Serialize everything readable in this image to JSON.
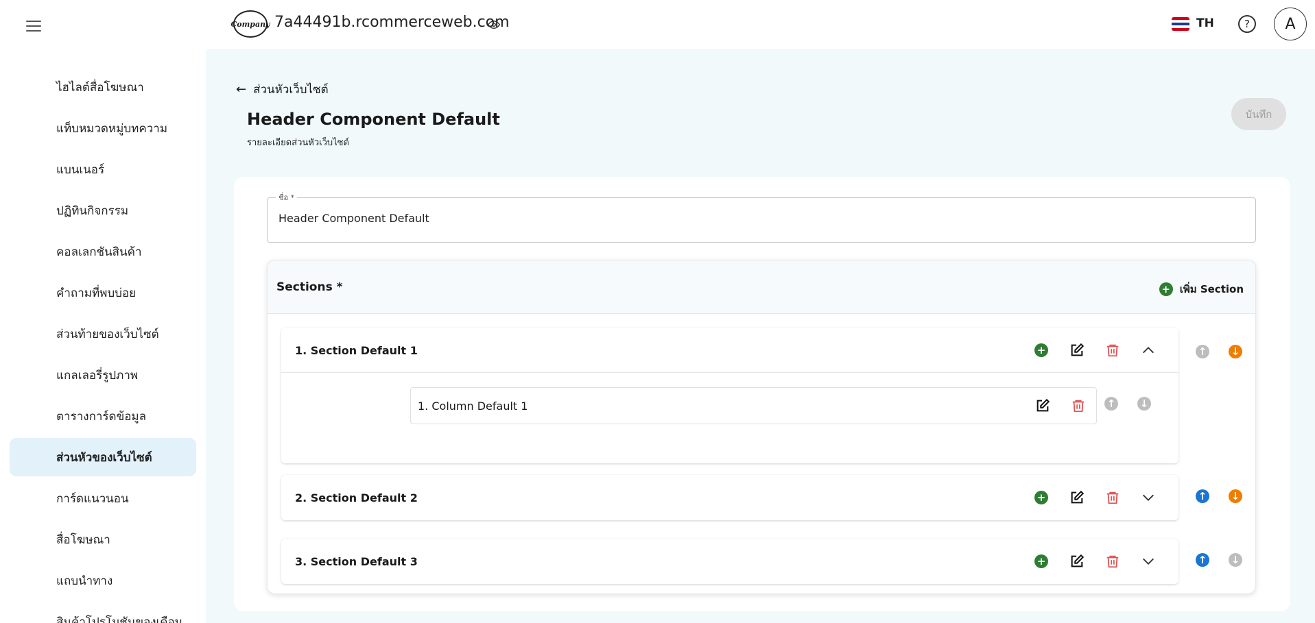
{
  "sidebar": {
    "items": [
      {
        "label": "ไฮไลต์สื่อโฆษณา",
        "active": false
      },
      {
        "label": "แท็บหมวดหมู่บทความ",
        "active": false
      },
      {
        "label": "แบนเนอร์",
        "active": false
      },
      {
        "label": "ปฏิทินกิจกรรม",
        "active": false
      },
      {
        "label": "คอลเลกชันสินค้า",
        "active": false
      },
      {
        "label": "คำถามที่พบบ่อย",
        "active": false
      },
      {
        "label": "ส่วนท้ายของเว็บไซต์",
        "active": false
      },
      {
        "label": "แกลเลอรี่รูปภาพ",
        "active": false
      },
      {
        "label": "ตารางการ์ดข้อมูล",
        "active": false
      },
      {
        "label": "ส่วนหัวของเว็บไซต์",
        "active": true
      },
      {
        "label": "การ์ดแนวนอน",
        "active": false
      },
      {
        "label": "สื่อโฆษณา",
        "active": false
      },
      {
        "label": "แถบนำทาง",
        "active": false
      },
      {
        "label": "สินค้าโปรโมชันของเดือน",
        "active": false
      }
    ]
  },
  "topbar": {
    "logo_text": "Company",
    "site_url": "7a44491b.rcommerceweb.com",
    "language": "TH",
    "avatar_initial": "A"
  },
  "page": {
    "back_label": "ส่วนหัวเว็บไซต์",
    "title": "Header Component Default",
    "subtitle": "รายละเอียดส่วนหัวเว็บไซต์",
    "save_label": "บันทึก"
  },
  "form": {
    "name_label": "ชื่อ *",
    "name_value": "Header Component Default",
    "sections_title": "Sections *",
    "add_section_label": "เพิ่ม Section"
  },
  "sections": [
    {
      "label": "1. Section Default 1",
      "expanded": true,
      "columns": [
        {
          "label": "1. Column Default 1"
        }
      ]
    },
    {
      "label": "2. Section Default 2",
      "expanded": false,
      "columns": []
    },
    {
      "label": "3. Section Default 3",
      "expanded": false,
      "columns": []
    }
  ],
  "colors": {
    "accent_green": "#2e7d32",
    "delete_red": "#e05555",
    "move_up_blue": "#1976d2",
    "move_down_orange": "#ef7d00",
    "disabled_grey": "#bdbdbd",
    "active_nav_bg": "#e3f1fb"
  }
}
